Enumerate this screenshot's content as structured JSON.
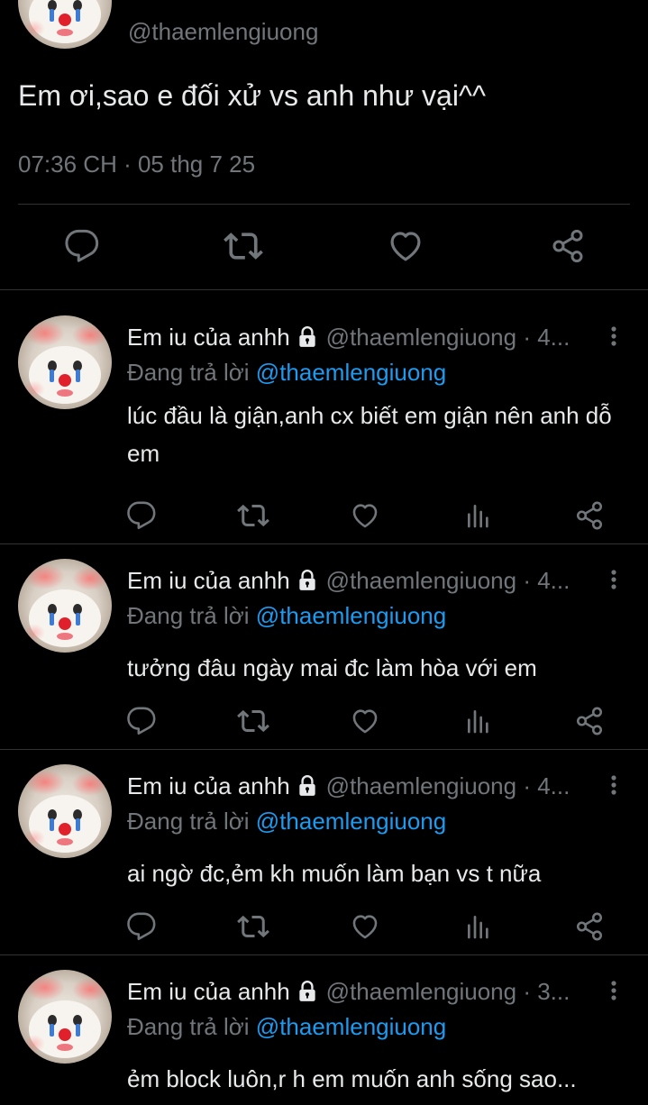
{
  "main": {
    "handle": "@thaemlengiuong",
    "text": "Em ơi,sao e đối xử vs anh như vại^^",
    "timestamp": "07:36 CH · 05 thg 7 25"
  },
  "replying_prefix": "Đang trả lời",
  "replies": [
    {
      "name": "Em iu của anhh",
      "handle_time": "@thaemlengiuong · 4...",
      "mention": "@thaemlengiuong",
      "text": "lúc đầu là giận,anh cx biết em giận nên anh dỗ em"
    },
    {
      "name": "Em iu của anhh",
      "handle_time": "@thaemlengiuong · 4...",
      "mention": "@thaemlengiuong",
      "text": "tưởng đâu ngày mai đc làm hòa với em"
    },
    {
      "name": "Em iu của anhh",
      "handle_time": "@thaemlengiuong · 4...",
      "mention": "@thaemlengiuong",
      "text": "ai ngờ đc,ẻm kh muốn làm bạn vs t nữa"
    },
    {
      "name": "Em iu của anhh",
      "handle_time": "@thaemlengiuong · 3...",
      "mention": "@thaemlengiuong",
      "text": "ẻm block luôn,r h em muốn anh sống sao..."
    }
  ],
  "colors": {
    "background": "#000000",
    "text": "#e7e9ea",
    "muted": "#71767b",
    "link": "#1d9bf0",
    "divider": "#2f3336"
  },
  "icons": {
    "action_bar": [
      "reply-icon",
      "retweet-icon",
      "like-icon",
      "share-icon"
    ],
    "reply_actions": [
      "reply-icon",
      "retweet-icon",
      "like-icon",
      "views-icon",
      "share-icon"
    ],
    "header": [
      "lock-icon",
      "more-icon"
    ]
  }
}
